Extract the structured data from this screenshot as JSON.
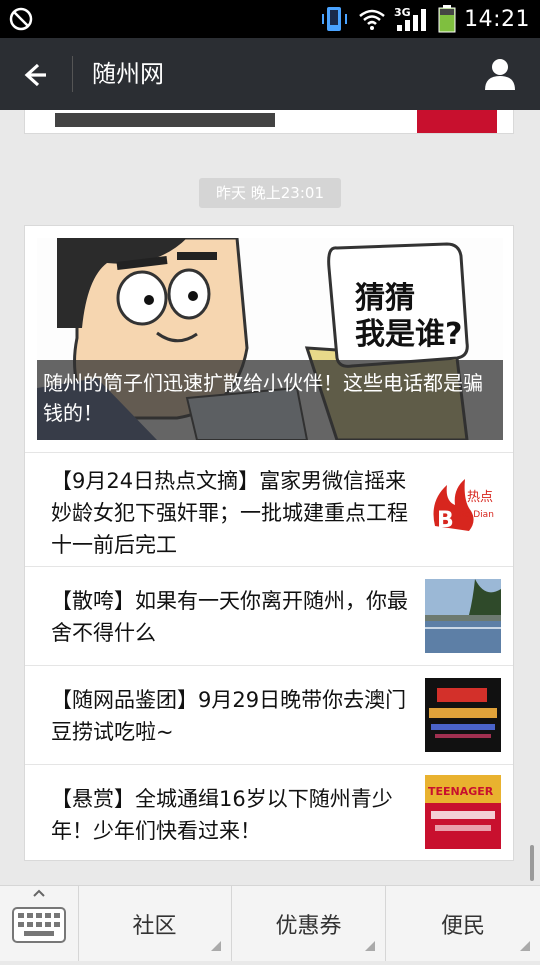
{
  "status_bar": {
    "time": "14:21",
    "network": "3G"
  },
  "header": {
    "title": "随州网"
  },
  "timestamp": "昨天 晚上23:01",
  "hero": {
    "caption": "随州的筒子们迅速扩散给小伙伴！这些电话都是骗钱的！",
    "bubble_text_line1": "猜猜",
    "bubble_text_line2": "我是谁?"
  },
  "articles": [
    {
      "title": "【9月24日热点文摘】富家男微信摇来妙龄女犯下强奸罪；一批城建重点工程十一前后完工",
      "thumb_label": "热点",
      "thumb_sub": "Re Dian"
    },
    {
      "title": "【散咵】如果有一天你离开随州，你最舍不得什么"
    },
    {
      "title": "【随网品鉴团】9月29日晚带你去澳门豆捞试吃啦~"
    },
    {
      "title": "【悬赏】全城通缉16岁以下随州青少年！少年们快看过来！",
      "thumb_label": "TEENAGER"
    }
  ],
  "bottom_tabs": [
    {
      "label": "社区"
    },
    {
      "label": "优惠券"
    },
    {
      "label": "便民"
    }
  ]
}
